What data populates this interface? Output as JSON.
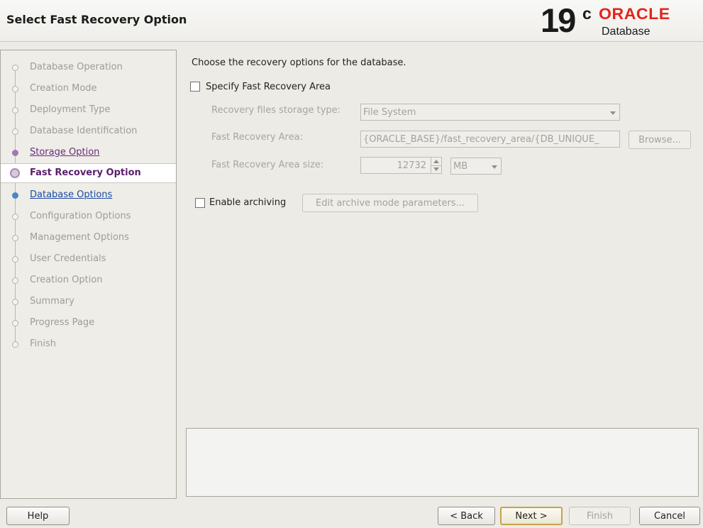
{
  "header": {
    "title": "Select Fast Recovery Option",
    "brand": {
      "version": "19",
      "version_sup": "c",
      "vendor": "ORACLE",
      "product": "Database"
    }
  },
  "nav": {
    "items": [
      {
        "label": "Database Operation",
        "state": "done"
      },
      {
        "label": "Creation Mode",
        "state": "done"
      },
      {
        "label": "Deployment Type",
        "state": "done"
      },
      {
        "label": "Database Identification",
        "state": "done"
      },
      {
        "label": "Storage Option",
        "state": "visited"
      },
      {
        "label": "Fast Recovery Option",
        "state": "current"
      },
      {
        "label": "Database Options",
        "state": "next"
      },
      {
        "label": "Configuration Options",
        "state": "pending"
      },
      {
        "label": "Management Options",
        "state": "pending"
      },
      {
        "label": "User Credentials",
        "state": "pending"
      },
      {
        "label": "Creation Option",
        "state": "pending"
      },
      {
        "label": "Summary",
        "state": "pending"
      },
      {
        "label": "Progress Page",
        "state": "pending"
      },
      {
        "label": "Finish",
        "state": "pending"
      }
    ]
  },
  "main": {
    "intro": "Choose the recovery options for the database.",
    "specify_fra": {
      "label": "Specify Fast Recovery Area",
      "checked": false
    },
    "storage_type": {
      "label": "Recovery files storage type:",
      "value": "File System"
    },
    "fra_location": {
      "label": "Fast Recovery Area:",
      "value": "{ORACLE_BASE}/fast_recovery_area/{DB_UNIQUE_",
      "browse_label": "Browse..."
    },
    "fra_size": {
      "label": "Fast Recovery Area size:",
      "value": "12732",
      "unit": "MB"
    },
    "archiving": {
      "label": "Enable archiving",
      "checked": false,
      "edit_label": "Edit archive mode parameters..."
    }
  },
  "footer": {
    "help": "Help",
    "back": "< Back",
    "next": "Next >",
    "finish": "Finish",
    "cancel": "Cancel"
  },
  "colors": {
    "accent_current": "#5a1e6c",
    "link_next": "#1e4ba0",
    "oracle_red": "#e1261c"
  }
}
